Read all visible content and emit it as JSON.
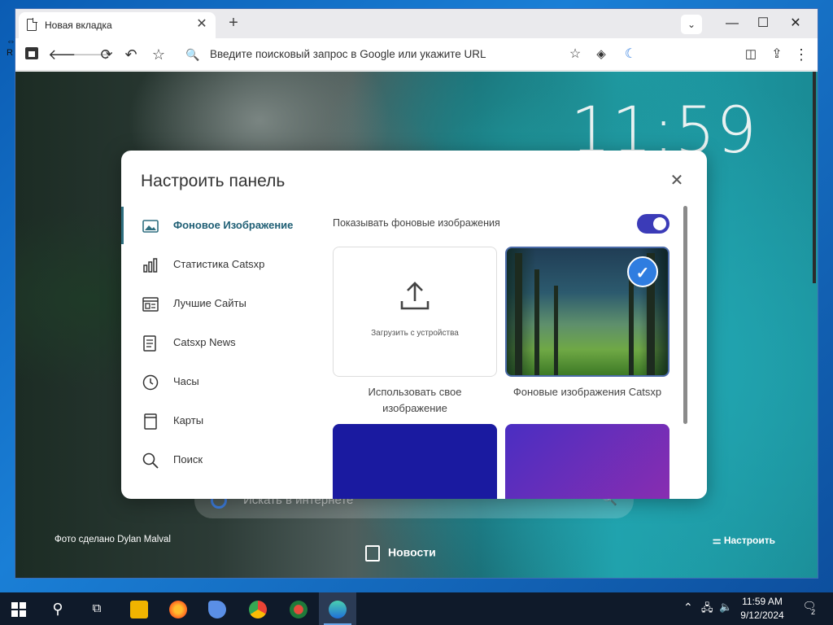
{
  "browser": {
    "tab_title": "Новая вкладка",
    "omnibox_placeholder": "Введите поисковый запрос в Google или укажите URL"
  },
  "page": {
    "clock": "11:59",
    "search_placeholder": "Искать в интернете",
    "photo_credit": "Фото сделано Dylan Malval",
    "news_label": "Новости",
    "customize_label": "Настроить"
  },
  "dialog": {
    "title": "Настроить панель",
    "nav": [
      {
        "label": "Фоновое Изображение",
        "icon": "image-icon",
        "active": true
      },
      {
        "label": "Статистика Catsxp",
        "icon": "stats-icon"
      },
      {
        "label": "Лучшие Сайты",
        "icon": "top-sites-icon"
      },
      {
        "label": "Catsxp News",
        "icon": "news-icon"
      },
      {
        "label": "Часы",
        "icon": "clock-icon"
      },
      {
        "label": "Карты",
        "icon": "cards-icon"
      },
      {
        "label": "Поиск",
        "icon": "search-icon"
      }
    ],
    "show_backgrounds_label": "Показывать фоновые изображения",
    "show_backgrounds_enabled": true,
    "upload_caption": "Загрузить с устройства",
    "upload_label_line1": "Использовать свое",
    "upload_label_line2": "изображение",
    "catsxp_label": "Фоновые изображения Catsxp",
    "catsxp_selected": true,
    "swatch_colors": [
      "#1a1aa0",
      "#6b2dba"
    ]
  },
  "taskbar": {
    "time": "11:59 AM",
    "date": "9/12/2024",
    "notification_count": "2"
  },
  "desktop": {
    "mark": "R"
  }
}
